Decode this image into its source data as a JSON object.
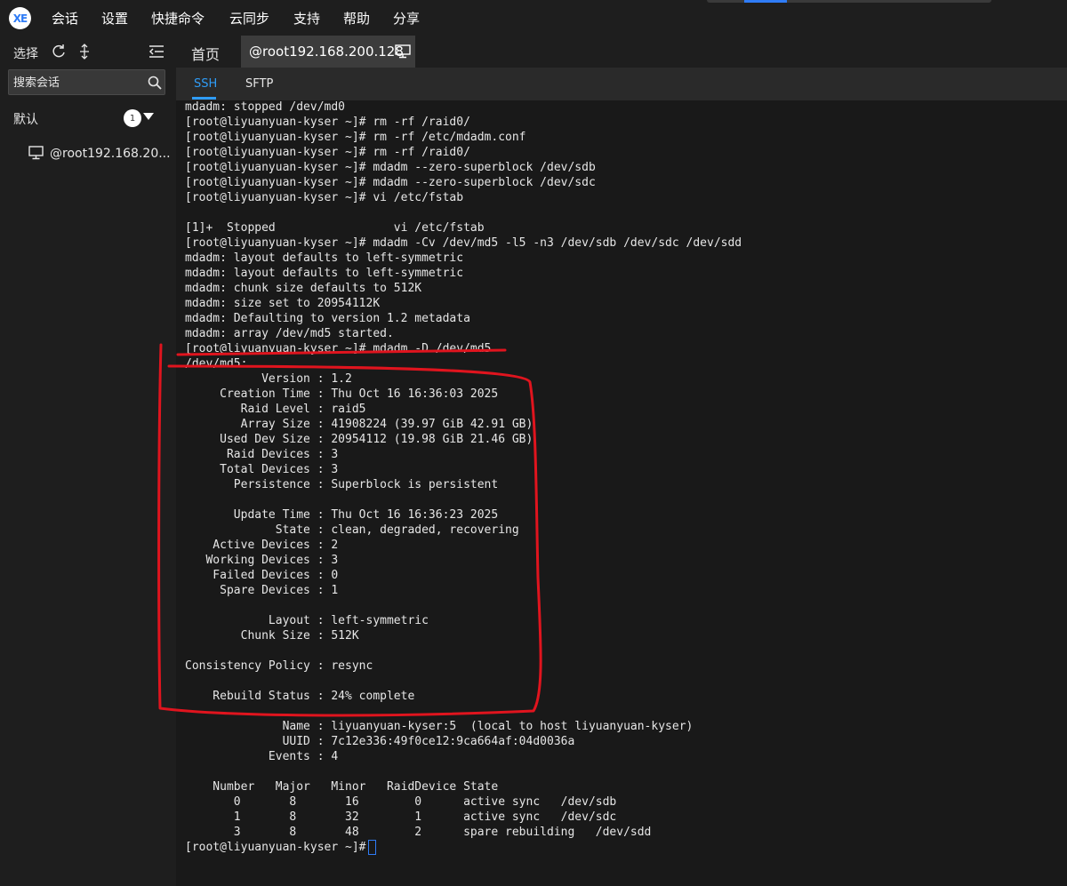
{
  "menu": {
    "logo_text": "XE",
    "items": [
      "会话",
      "设置",
      "快捷命令",
      "云同步",
      "支持",
      "帮助",
      "分享"
    ]
  },
  "sidebar": {
    "select_label": "选择",
    "search_placeholder": "搜索会话",
    "group_label": "默认",
    "group_count": "1",
    "session_label": "@root192.168.20..."
  },
  "tabs": {
    "home_label": "首页",
    "session_label": "@root192.168.200.128"
  },
  "subtabs": {
    "ssh_label": "SSH",
    "sftp_label": "SFTP"
  },
  "terminal": {
    "lines": [
      "mdadm: stopped /dev/md0",
      "[root@liyuanyuan-kyser ~]# rm -rf /raid0/",
      "[root@liyuanyuan-kyser ~]# rm -rf /etc/mdadm.conf",
      "[root@liyuanyuan-kyser ~]# rm -rf /raid0/",
      "[root@liyuanyuan-kyser ~]# mdadm --zero-superblock /dev/sdb",
      "[root@liyuanyuan-kyser ~]# mdadm --zero-superblock /dev/sdc",
      "[root@liyuanyuan-kyser ~]# vi /etc/fstab",
      "",
      "[1]+  Stopped                 vi /etc/fstab",
      "[root@liyuanyuan-kyser ~]# mdadm -Cv /dev/md5 -l5 -n3 /dev/sdb /dev/sdc /dev/sdd",
      "mdadm: layout defaults to left-symmetric",
      "mdadm: layout defaults to left-symmetric",
      "mdadm: chunk size defaults to 512K",
      "mdadm: size set to 20954112K",
      "mdadm: Defaulting to version 1.2 metadata",
      "mdadm: array /dev/md5 started.",
      "[root@liyuanyuan-kyser ~]# mdadm -D /dev/md5",
      "/dev/md5:",
      "           Version : 1.2",
      "     Creation Time : Thu Oct 16 16:36:03 2025",
      "        Raid Level : raid5",
      "        Array Size : 41908224 (39.97 GiB 42.91 GB)",
      "     Used Dev Size : 20954112 (19.98 GiB 21.46 GB)",
      "      Raid Devices : 3",
      "     Total Devices : 3",
      "       Persistence : Superblock is persistent",
      "",
      "       Update Time : Thu Oct 16 16:36:23 2025",
      "             State : clean, degraded, recovering",
      "    Active Devices : 2",
      "   Working Devices : 3",
      "    Failed Devices : 0",
      "     Spare Devices : 1",
      "",
      "            Layout : left-symmetric",
      "        Chunk Size : 512K",
      "",
      "Consistency Policy : resync",
      "",
      "    Rebuild Status : 24% complete",
      "",
      "              Name : liyuanyuan-kyser:5  (local to host liyuanyuan-kyser)",
      "              UUID : 7c12e336:49f0ce12:9ca664af:04d0036a",
      "            Events : 4",
      "",
      "    Number   Major   Minor   RaidDevice State",
      "       0       8       16        0      active sync   /dev/sdb",
      "       1       8       32        1      active sync   /dev/sdc",
      "       3       8       48        2      spare rebuilding   /dev/sdd"
    ],
    "prompt": "[root@liyuanyuan-kyser ~]#"
  },
  "colors": {
    "accent": "#2f9cf6",
    "annotation": "#e0141e",
    "terminal_bg": "#191919"
  }
}
